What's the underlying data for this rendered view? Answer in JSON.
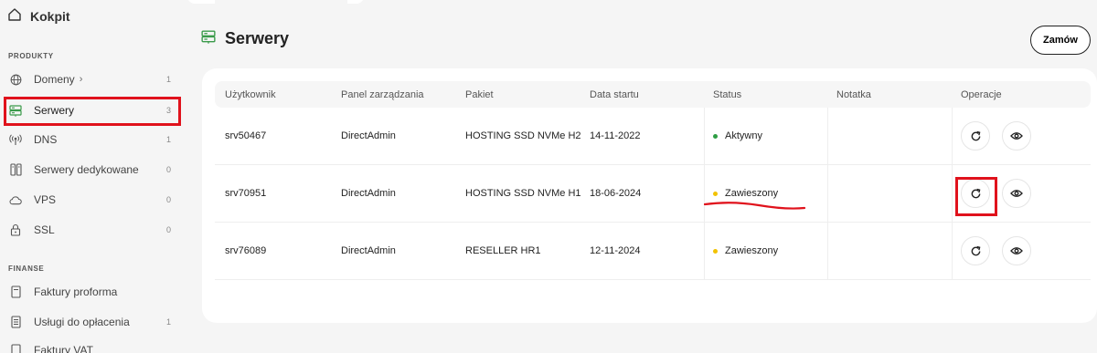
{
  "sidebar": {
    "home_label": "Kokpit",
    "section_products": "PRODUKTY",
    "section_finance": "FINANSE",
    "products": [
      {
        "label": "Domeny",
        "count": "1",
        "icon": "globe-icon",
        "has_chevron": true,
        "chevron": "›"
      },
      {
        "label": "Serwery",
        "count": "3",
        "icon": "server-icon",
        "active": true
      },
      {
        "label": "DNS",
        "count": "1",
        "icon": "antenna-icon"
      },
      {
        "label": "Serwery dedykowane",
        "count": "0",
        "icon": "dedicated-server-icon"
      },
      {
        "label": "VPS",
        "count": "0",
        "icon": "cloud-icon"
      },
      {
        "label": "SSL",
        "count": "0",
        "icon": "lock-icon"
      }
    ],
    "finance": [
      {
        "label": "Faktury proforma",
        "icon": "document-icon"
      },
      {
        "label": "Usługi do opłacenia",
        "count": "1",
        "icon": "list-document-icon"
      },
      {
        "label": "Faktury VAT",
        "icon": "document-icon"
      }
    ]
  },
  "header": {
    "title": "Serwery",
    "title_icon": "server-icon",
    "order_button": "Zamów"
  },
  "table": {
    "columns": [
      "Użytkownik",
      "Panel zarządzania",
      "Pakiet",
      "Data startu",
      "Status",
      "Notatka",
      "Operacje"
    ],
    "rows": [
      {
        "user": "srv50467",
        "panel": "DirectAdmin",
        "package": "HOSTING SSD NVMe H2",
        "start": "14-11-2022",
        "status": "Aktywny",
        "status_color": "#2e9e44",
        "note": ""
      },
      {
        "user": "srv70951",
        "panel": "DirectAdmin",
        "package": "HOSTING SSD NVMe H1",
        "start": "18-06-2024",
        "status": "Zawieszony",
        "status_color": "#f2c200",
        "note": ""
      },
      {
        "user": "srv76089",
        "panel": "DirectAdmin",
        "package": "RESELLER HR1",
        "start": "12-11-2024",
        "status": "Zawieszony",
        "status_color": "#f2c200",
        "note": ""
      }
    ]
  },
  "colors": {
    "annotation_red": "#e0121c",
    "active_green": "#2e9e44",
    "suspended_yellow": "#f2c200",
    "server_icon_green": "#3a9a4a"
  }
}
